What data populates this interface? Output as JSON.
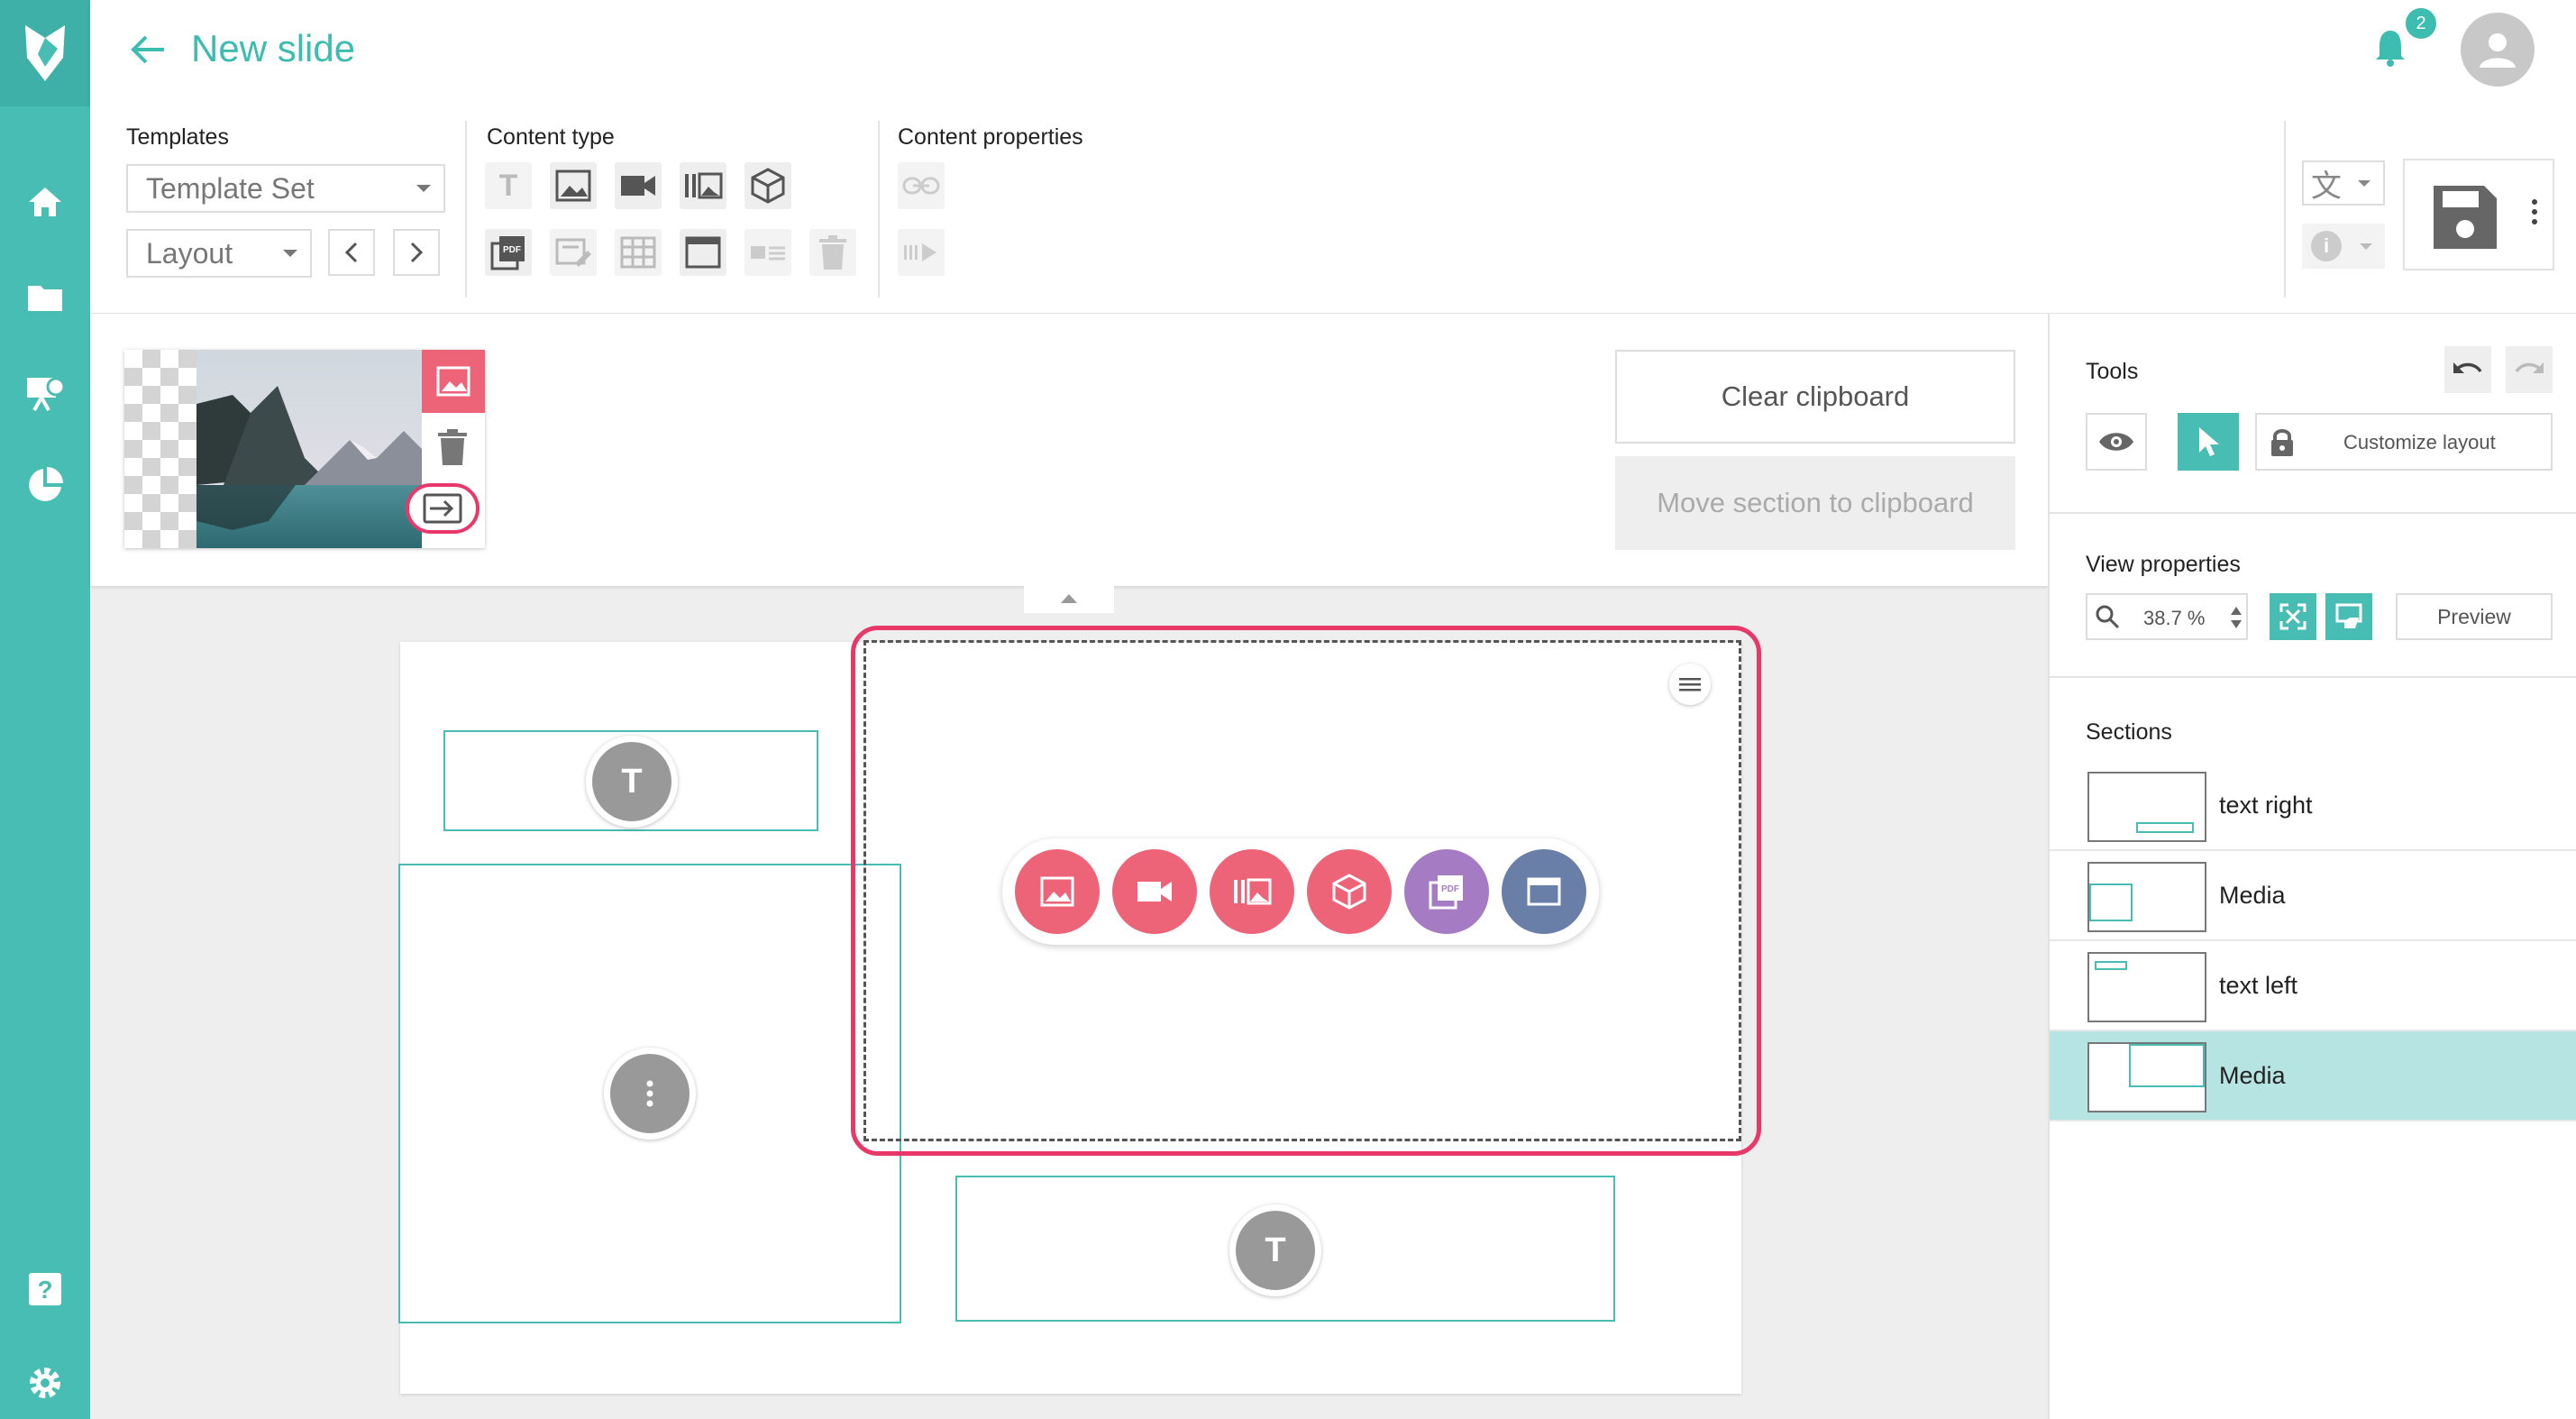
{
  "header": {
    "title": "New slide",
    "notification_count": "2",
    "icons": [
      "back-arrow-icon",
      "bell-icon",
      "user-avatar-icon"
    ]
  },
  "rail": {
    "icons": [
      "fox-logo-icon",
      "home-icon",
      "folder-icon",
      "presentation-icon",
      "pie-chart-icon",
      "help-icon",
      "settings-icon"
    ]
  },
  "toolbar": {
    "templates_label": "Templates",
    "template_set_value": "Template Set",
    "layout_value": "Layout",
    "content_type_label": "Content type",
    "content_properties_label": "Content properties",
    "content_type_icons": [
      "text-icon",
      "image-icon",
      "video-icon",
      "gallery-icon",
      "3d-cube-icon",
      "pdf-icon",
      "form-icon",
      "table-icon",
      "window-icon",
      "card-icon",
      "trash-icon"
    ],
    "content_property_icons": [
      "link-icon",
      "animation-icon"
    ]
  },
  "clipboard": {
    "clear_label": "Clear clipboard",
    "move_label": "Move section to clipboard"
  },
  "tools": {
    "label": "Tools",
    "customize_layout_label": "Customize layout"
  },
  "view_properties": {
    "label": "View properties",
    "zoom_value": "38.7 %",
    "preview_label": "Preview"
  },
  "sections": {
    "label": "Sections",
    "items": [
      {
        "name": "text right",
        "selected": false
      },
      {
        "name": "Media",
        "selected": false
      },
      {
        "name": "text left",
        "selected": false
      },
      {
        "name": "Media",
        "selected": true
      }
    ]
  },
  "canvas": {
    "text_glyph": "T",
    "media_picker_icons": [
      "image-icon",
      "video-icon",
      "gallery-icon",
      "3d-cube-icon",
      "pdf-icon",
      "window-icon"
    ]
  },
  "colors": {
    "teal": "#47bdb4",
    "pink": "#ed6478",
    "highlight": "#e8386a",
    "purple": "#a57bc3",
    "slate": "#6a7fa8",
    "selected_row": "#b6e4e2"
  }
}
